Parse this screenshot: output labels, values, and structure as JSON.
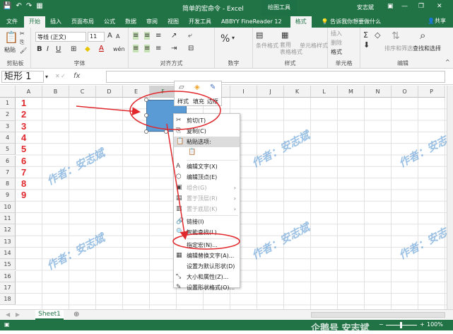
{
  "title_bar": {
    "quick_access": [
      "💾",
      "↶",
      "↷",
      "▦"
    ],
    "title": "简单的宏命令 - Excel",
    "context_tools": "绘图工具",
    "user": "安志斌",
    "window_buttons": [
      "▣",
      "—",
      "❐",
      "✕"
    ]
  },
  "tabs": [
    "文件",
    "开始",
    "插入",
    "页面布局",
    "公式",
    "数据",
    "审阅",
    "视图",
    "开发工具",
    "ABBYY FineReader 12",
    "格式"
  ],
  "tell_me": "告诉我你想要做什么",
  "share": "共享",
  "ribbon": {
    "clipboard": {
      "paste": "粘贴",
      "label": "剪贴板"
    },
    "font": {
      "name": "等线 (正文)",
      "size": "11",
      "grow": "A",
      "shrink": "A",
      "bold": "B",
      "italic": "I",
      "underline": "U",
      "label": "字体",
      "wen": "wén"
    },
    "alignment": {
      "label": "对齐方式"
    },
    "number": {
      "label": "数字",
      "percent": "%",
      "pct_arrow": "▾"
    },
    "styles": {
      "conditional": "条件格式",
      "table": "套用\n表格格式",
      "cell": "单元格样式",
      "label": "样式"
    },
    "cells": {
      "insert": "插入",
      "delete": "删除",
      "format": "格式",
      "label": "单元格"
    },
    "editing": {
      "sort": "排序和筛选",
      "find": "查找和选择",
      "label": "编辑"
    }
  },
  "formula_bar": {
    "name_box": "矩形 1",
    "fx": "fx",
    "value": ""
  },
  "columns": [
    "A",
    "B",
    "C",
    "D",
    "E",
    "F",
    "G",
    "H",
    "I",
    "J",
    "K",
    "L",
    "M",
    "N",
    "O",
    "P"
  ],
  "rows": [
    "1",
    "2",
    "3",
    "4",
    "5",
    "6",
    "7",
    "8",
    "9",
    "10",
    "11",
    "12",
    "13",
    "14",
    "15",
    "16",
    "17",
    "18"
  ],
  "numbers": [
    "1",
    "2",
    "3",
    "4",
    "5",
    "6",
    "7",
    "8",
    "9"
  ],
  "watermark": "作者：安志斌",
  "mini_toolbar": {
    "style": "样式",
    "fill": "填充",
    "outline": "边框"
  },
  "context_menu": [
    {
      "label": "剪切(T)",
      "icon": "✂",
      "state": "normal"
    },
    {
      "label": "复制(C)",
      "icon": "⎘",
      "state": "normal"
    },
    {
      "label": "粘贴选项:",
      "icon": "📋",
      "state": "highlight"
    },
    {
      "label": "",
      "icon": "📋",
      "state": "normal"
    },
    {
      "label": "编辑文字(X)",
      "icon": "A",
      "state": "normal"
    },
    {
      "label": "编辑顶点(E)",
      "icon": "⬡",
      "state": "normal"
    },
    {
      "label": "组合(G)",
      "icon": "▣",
      "state": "disabled",
      "sub": "›"
    },
    {
      "label": "置于顶层(R)",
      "icon": "▤",
      "state": "disabled",
      "sub": "›"
    },
    {
      "label": "置于底层(K)",
      "icon": "▥",
      "state": "disabled",
      "sub": "›"
    },
    {
      "label": "链接(I)",
      "icon": "🔗",
      "state": "normal"
    },
    {
      "label": "智能查找(L)",
      "icon": "🔍",
      "state": "normal"
    },
    {
      "label": "指定宏(N)...",
      "icon": "",
      "state": "normal"
    },
    {
      "label": "编辑替换文字(A)...",
      "icon": "▦",
      "state": "normal"
    },
    {
      "label": "设置为默认形状(D)",
      "icon": "",
      "state": "normal"
    },
    {
      "label": "大小和属性(Z)...",
      "icon": "⤡",
      "state": "normal"
    },
    {
      "label": "设置形状格式(O)...",
      "icon": "✎",
      "state": "normal"
    }
  ],
  "sheet_tab": "Sheet1",
  "add_sheet": "⊕",
  "status": {
    "zoom": "100%",
    "left_icon": "▣",
    "minus": "−",
    "plus": "+"
  },
  "bottom_watermark": "企鹅号 安志斌",
  "colors": {
    "excel_green": "#217346",
    "annotation_red": "#e0282d",
    "shape_fill": "#5b9bd5"
  }
}
